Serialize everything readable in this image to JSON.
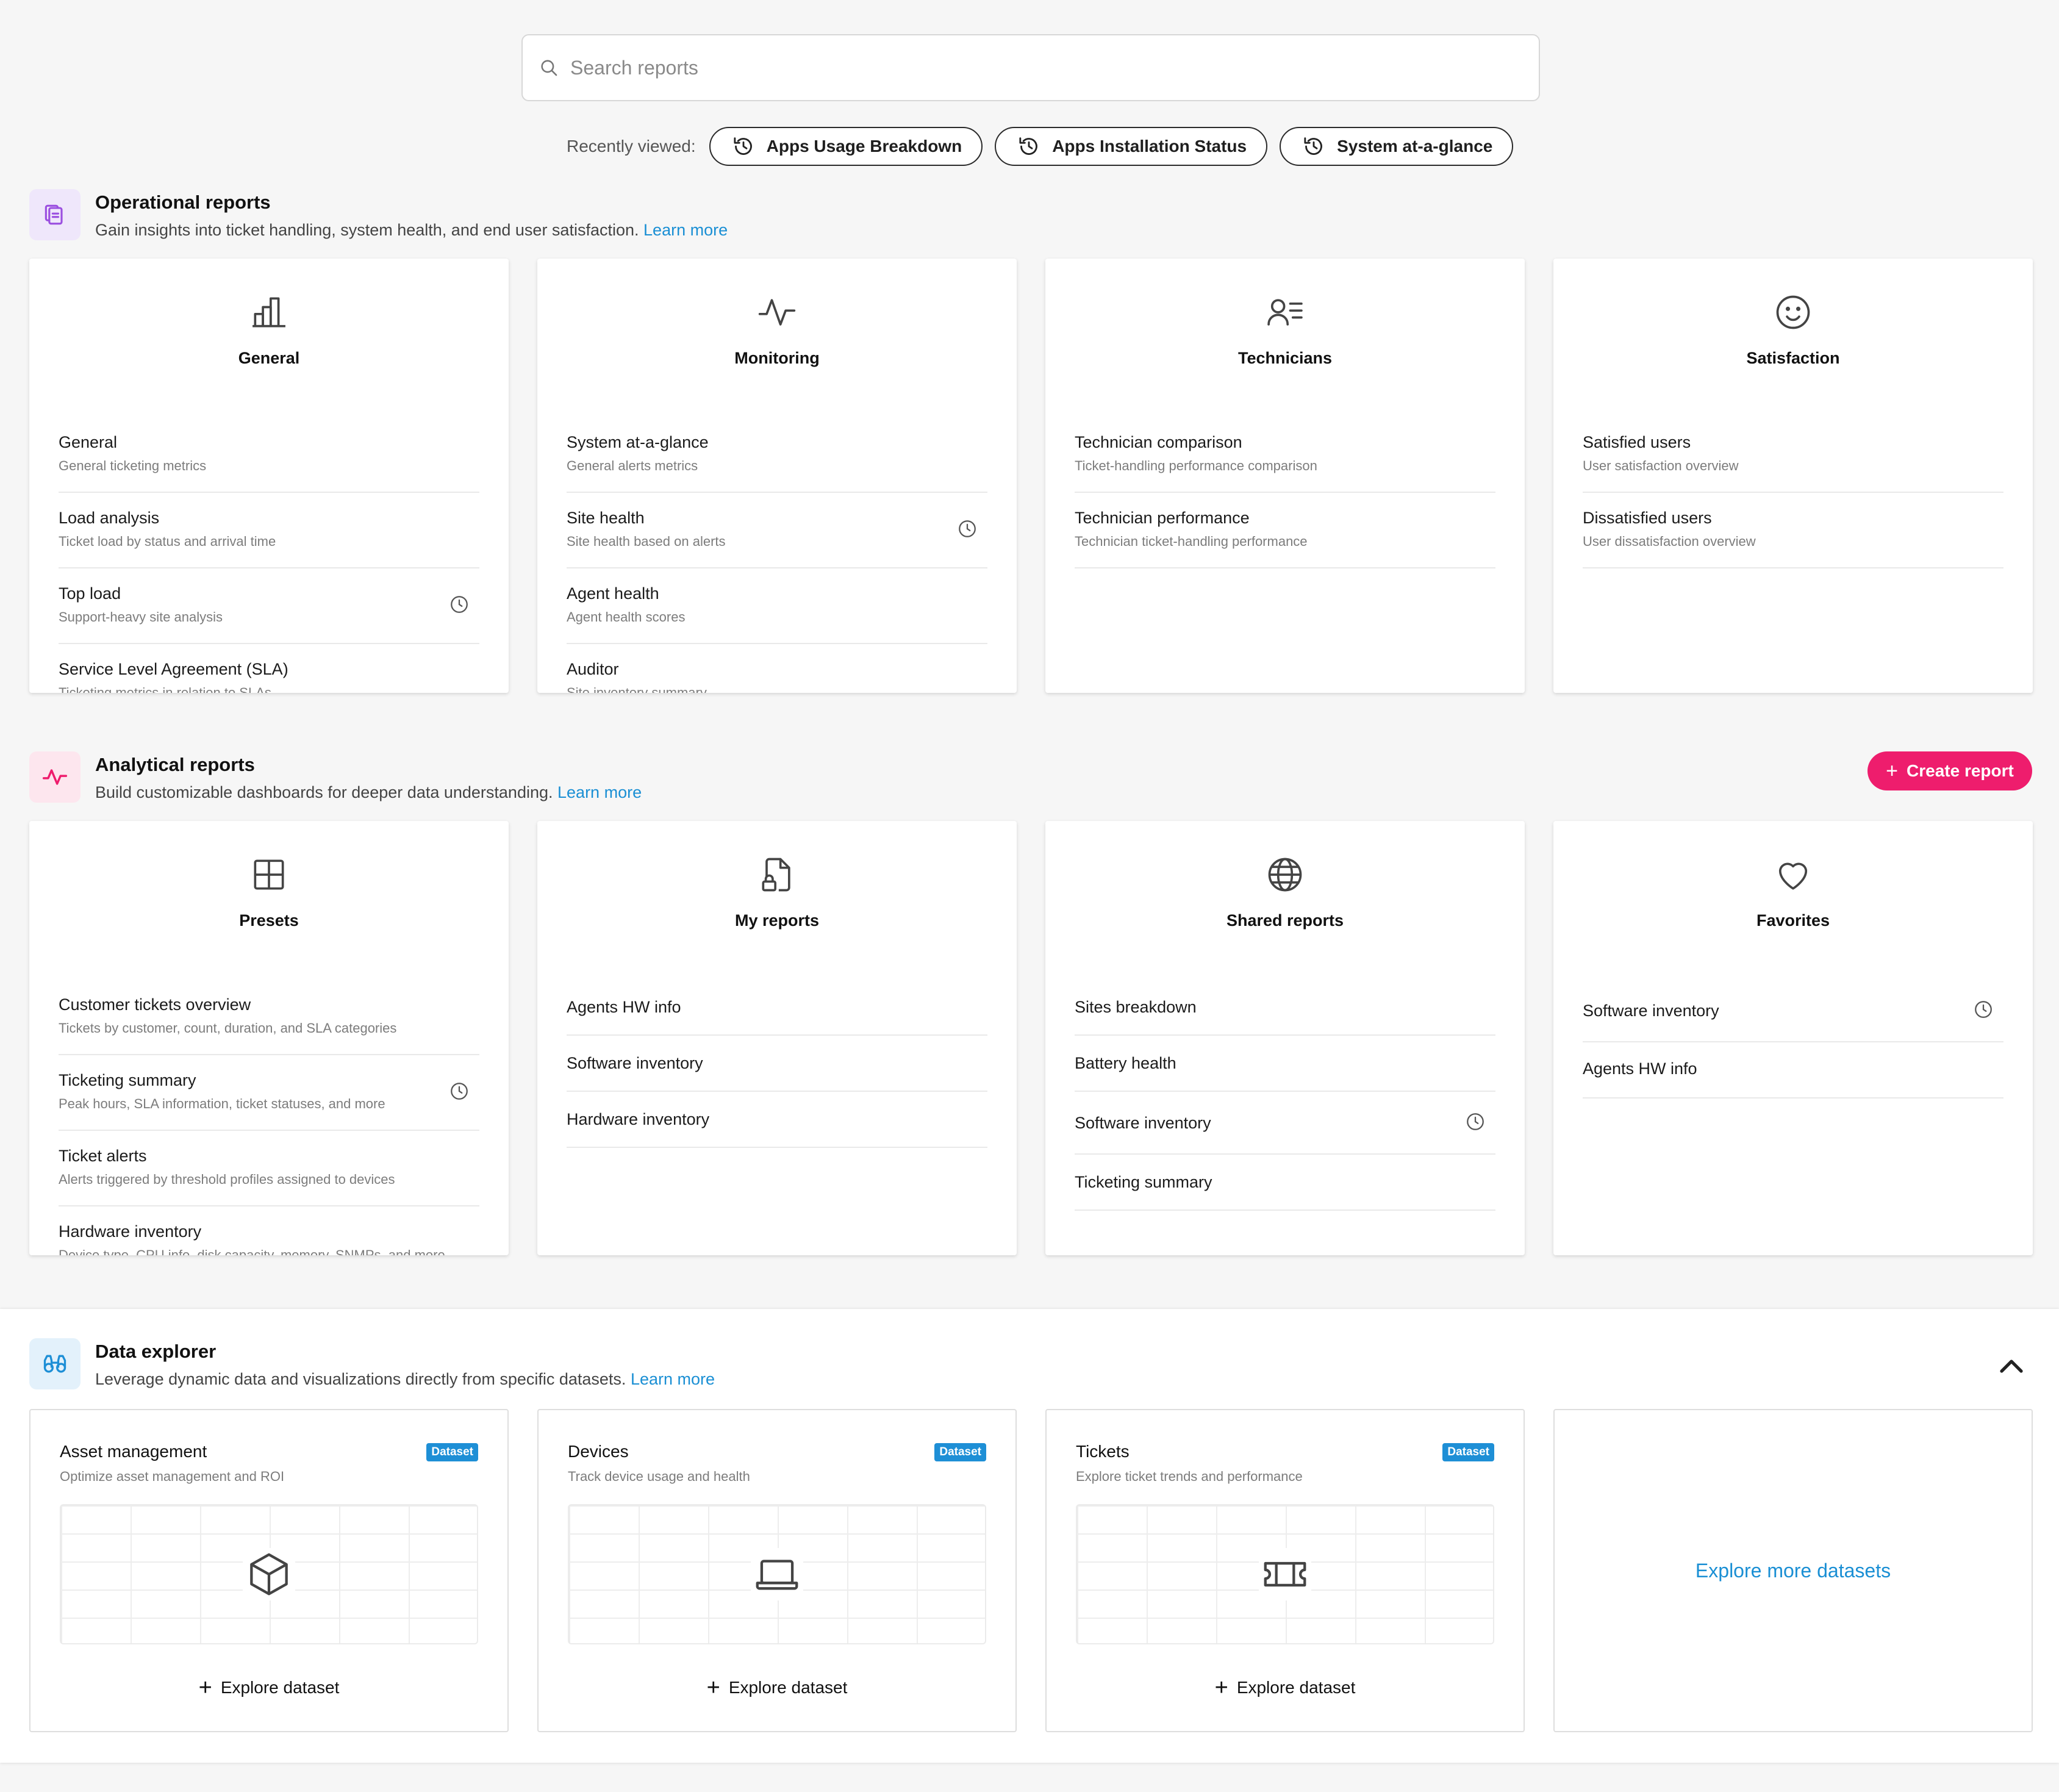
{
  "search": {
    "placeholder": "Search reports"
  },
  "recent": {
    "label": "Recently viewed:",
    "items": [
      "Apps Usage Breakdown",
      "Apps Installation Status",
      "System at-a-glance"
    ]
  },
  "operational": {
    "title": "Operational reports",
    "desc": "Gain insights into ticket handling, system health, and end user satisfaction.",
    "learn_more": "Learn more",
    "cards": [
      {
        "title": "General",
        "icon": "bar-chart-icon",
        "items": [
          {
            "title": "General",
            "sub": "General ticketing metrics",
            "recent": false
          },
          {
            "title": "Load analysis",
            "sub": "Ticket load by status and arrival time",
            "recent": false
          },
          {
            "title": "Top load",
            "sub": "Support-heavy site analysis",
            "recent": true
          },
          {
            "title": "Service Level Agreement (SLA)",
            "sub": "Ticketing metrics in relation to SLAs",
            "recent": false
          }
        ]
      },
      {
        "title": "Monitoring",
        "icon": "pulse-icon",
        "items": [
          {
            "title": "System at-a-glance",
            "sub": "General alerts metrics",
            "recent": false
          },
          {
            "title": "Site health",
            "sub": "Site health based on alerts",
            "recent": true
          },
          {
            "title": "Agent health",
            "sub": "Agent health scores",
            "recent": false
          },
          {
            "title": "Auditor",
            "sub": "Site inventory summary",
            "recent": false
          }
        ]
      },
      {
        "title": "Technicians",
        "icon": "user-list-icon",
        "items": [
          {
            "title": "Technician comparison",
            "sub": "Ticket-handling performance comparison",
            "recent": false
          },
          {
            "title": "Technician performance",
            "sub": "Technician ticket-handling performance",
            "recent": false
          }
        ]
      },
      {
        "title": "Satisfaction",
        "icon": "smiley-icon",
        "items": [
          {
            "title": "Satisfied users",
            "sub": "User satisfaction overview",
            "recent": false
          },
          {
            "title": "Dissatisfied users",
            "sub": "User dissatisfaction overview",
            "recent": false
          }
        ]
      }
    ]
  },
  "analytical": {
    "title": "Analytical reports",
    "desc": "Build customizable dashboards for deeper data understanding.",
    "learn_more": "Learn more",
    "create_label": "Create report",
    "cards": [
      {
        "title": "Presets",
        "icon": "grid-icon",
        "items": [
          {
            "title": "Customer tickets overview",
            "sub": "Tickets by customer, count, duration, and SLA categories",
            "recent": false
          },
          {
            "title": "Ticketing summary",
            "sub": "Peak hours, SLA information, ticket statuses, and more",
            "recent": true
          },
          {
            "title": "Ticket alerts",
            "sub": "Alerts triggered by threshold profiles assigned to devices",
            "recent": false
          },
          {
            "title": "Hardware inventory",
            "sub": "Device type, CPU info, disk capacity, memory, SNMPs, and more",
            "recent": false
          }
        ]
      },
      {
        "title": "My reports",
        "icon": "locked-file-icon",
        "items": [
          {
            "title": "Agents HW info",
            "recent": false
          },
          {
            "title": "Software inventory",
            "recent": false
          },
          {
            "title": "Hardware inventory",
            "recent": false
          }
        ]
      },
      {
        "title": "Shared reports",
        "icon": "globe-icon",
        "items": [
          {
            "title": "Sites breakdown",
            "recent": false
          },
          {
            "title": "Battery health",
            "recent": false
          },
          {
            "title": "Software inventory",
            "recent": true
          },
          {
            "title": "Ticketing summary",
            "recent": false
          }
        ]
      },
      {
        "title": "Favorites",
        "icon": "heart-icon",
        "items": [
          {
            "title": "Software inventory",
            "recent": true
          },
          {
            "title": "Agents HW info",
            "recent": false
          }
        ]
      }
    ]
  },
  "explorer": {
    "title": "Data explorer",
    "desc": "Leverage dynamic data and visualizations directly from specific datasets.",
    "learn_more": "Learn more",
    "badge": "Dataset",
    "explore_label": "Explore dataset",
    "more_label": "Explore more datasets",
    "datasets": [
      {
        "title": "Asset management",
        "sub": "Optimize asset management and ROI",
        "icon": "cube-icon"
      },
      {
        "title": "Devices",
        "sub": "Track device usage and health",
        "icon": "laptop-icon"
      },
      {
        "title": "Tickets",
        "sub": "Explore ticket trends and performance",
        "icon": "ticket-icon"
      }
    ]
  },
  "colors": {
    "accent": "#ee1d6d",
    "link": "#1a8fd4",
    "operational_icon_bg": "#efe7fb",
    "analytical_icon_bg": "#fde6ee",
    "explorer_icon_bg": "#e3f1fb"
  }
}
